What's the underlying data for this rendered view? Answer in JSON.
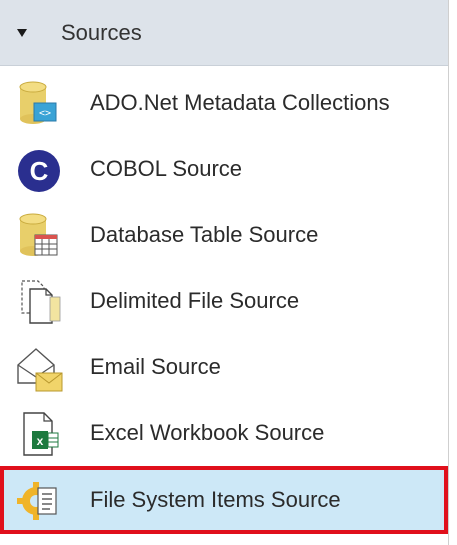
{
  "group": {
    "title": "Sources",
    "expanded_icon": "triangle-down-icon"
  },
  "items": [
    {
      "label": "ADO.Net Metadata Collections",
      "icon": "database-code-icon"
    },
    {
      "label": "COBOL Source",
      "icon": "cobol-c-icon"
    },
    {
      "label": "Database Table Source",
      "icon": "database-table-icon"
    },
    {
      "label": "Delimited File Source",
      "icon": "delimited-file-icon"
    },
    {
      "label": "Email Source",
      "icon": "email-icon"
    },
    {
      "label": "Excel Workbook Source",
      "icon": "excel-workbook-icon"
    },
    {
      "label": "File System Items Source",
      "icon": "file-system-items-icon",
      "selected": true
    }
  ],
  "colors": {
    "header_bg": "#dde3ea",
    "selected_bg": "#cde8f7",
    "selected_border": "#e0101c",
    "cobol_circle": "#2a2f8f",
    "database_gold": "#e8cf6a"
  }
}
